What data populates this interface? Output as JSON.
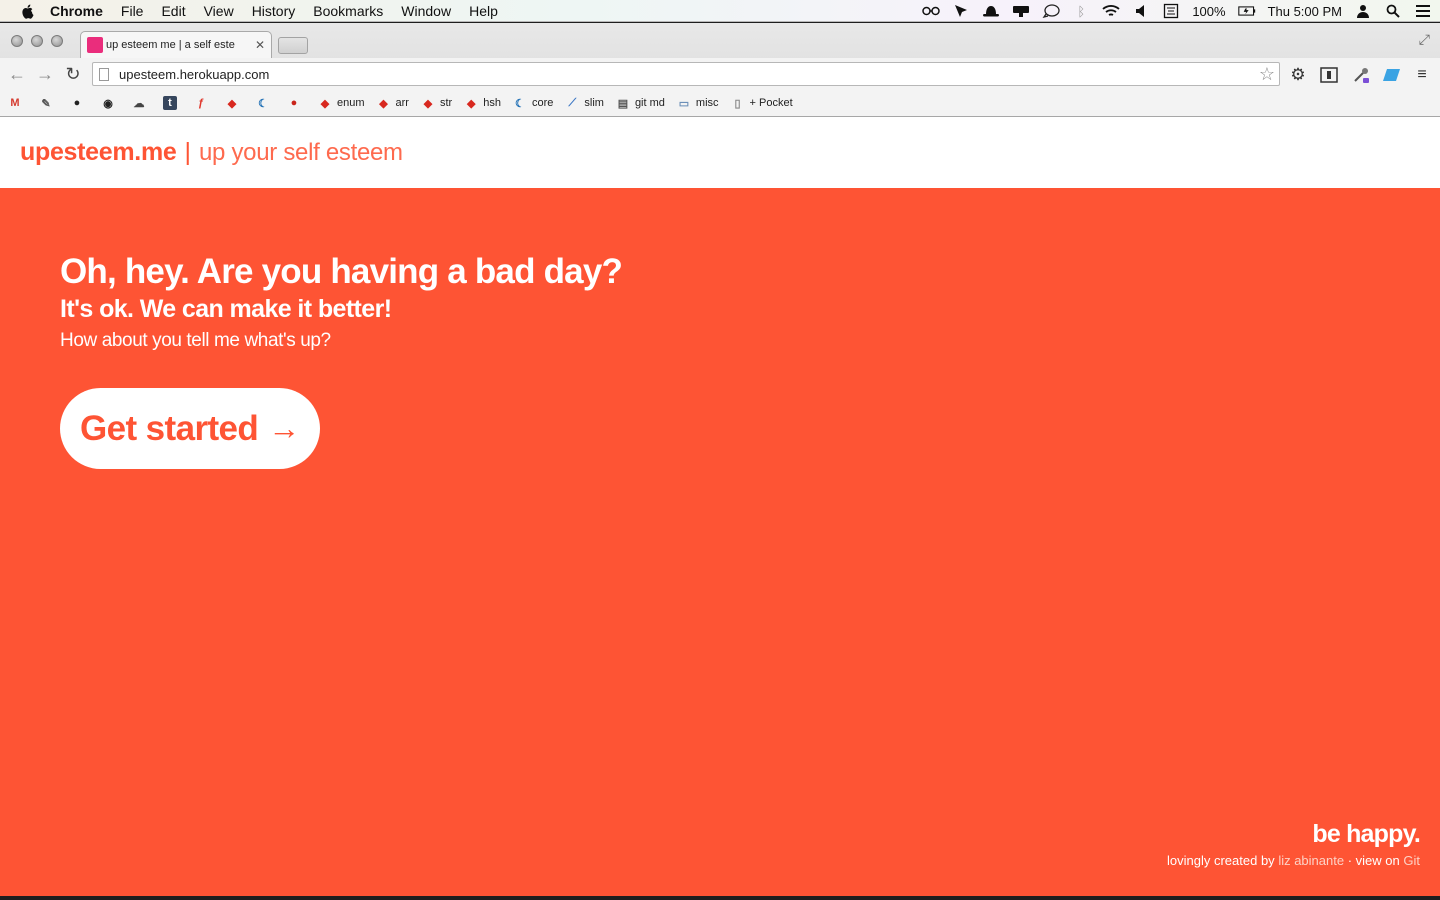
{
  "menubar": {
    "app": "Chrome",
    "items": [
      "File",
      "Edit",
      "View",
      "History",
      "Bookmarks",
      "Window",
      "Help"
    ],
    "battery": "100%",
    "clock": "Thu 5:00 PM"
  },
  "browser": {
    "tab_title": "up esteem me | a self este",
    "url": "upesteem.herokuapp.com",
    "bookmarks": [
      {
        "icon": "gmail-icon",
        "label": ""
      },
      {
        "icon": "bookmarklet-icon",
        "label": ""
      },
      {
        "icon": "github-circle-icon",
        "label": ""
      },
      {
        "icon": "github-cat-icon",
        "label": ""
      },
      {
        "icon": "cloud-icon",
        "label": ""
      },
      {
        "icon": "tumblr-icon",
        "label": "t"
      },
      {
        "icon": "foursquare-icon",
        "label": ""
      },
      {
        "icon": "ruby-icon",
        "label": ""
      },
      {
        "icon": "jquery-icon",
        "label": ""
      },
      {
        "icon": "ladybug-icon",
        "label": ""
      },
      {
        "icon": "ruby-icon",
        "label": "enum"
      },
      {
        "icon": "ruby-icon",
        "label": "arr"
      },
      {
        "icon": "ruby-icon",
        "label": "str"
      },
      {
        "icon": "ruby-icon",
        "label": "hsh"
      },
      {
        "icon": "jquery-icon",
        "label": "core"
      },
      {
        "icon": "slim-icon",
        "label": "slim"
      },
      {
        "icon": "document-icon",
        "label": "git md"
      },
      {
        "icon": "folder-icon",
        "label": "misc"
      },
      {
        "icon": "page-icon",
        "label": "+ Pocket"
      }
    ]
  },
  "site": {
    "brand": "upesteem.me",
    "separator": "|",
    "tagline": "up your self esteem",
    "hero_title": "Oh, hey. Are you having a bad day?",
    "hero_subtitle": "It's ok. We can make it better!",
    "hero_prompt": "How about you tell me what's up?",
    "cta_label": "Get started",
    "cta_arrow": "→",
    "footer_title": "be happy.",
    "footer_prefix": "lovingly created by",
    "footer_author": "liz abinante",
    "footer_mid": "· view on",
    "footer_link": "Git"
  },
  "colors": {
    "accent": "#fe5434",
    "tab_favicon": "#ea2d7c"
  }
}
